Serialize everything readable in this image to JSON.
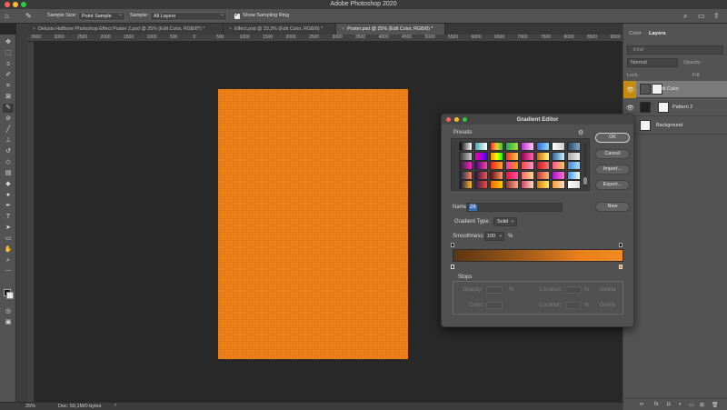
{
  "app": {
    "title": "Adobe Photoshop 2020"
  },
  "options_bar": {
    "sample_size_label": "Sample Size:",
    "sample_size_value": "Point Sample",
    "sample_label": "Sample:",
    "sample_value": "All Layers",
    "sampling_ring_label": "Show Sampling Ring",
    "sampling_ring_checked": true
  },
  "tabs": [
    {
      "label": "Delusio Halftone Photoshop Effect Poster 2.psd @ 25% (Edit Color, RGB/8*) *",
      "active": false
    },
    {
      "label": "Effect.psd @ 33,3% (Edit Color, RGB/8) *",
      "active": false
    },
    {
      "label": "Poster.psd @ 25% (Edit Color, RGB/8) *",
      "active": true
    }
  ],
  "ruler_ticks": [
    "3500",
    "3000",
    "2500",
    "2000",
    "1500",
    "1000",
    "500",
    "0",
    "500",
    "1000",
    "1500",
    "2000",
    "2500",
    "3000",
    "3500",
    "4000",
    "4500",
    "5000",
    "5500",
    "6000",
    "6500",
    "7000",
    "7500",
    "8000",
    "8500",
    "9000",
    "9500"
  ],
  "status_bar": {
    "zoom": "25%",
    "doc": "Doc: 50,1M/0 bytes"
  },
  "panels": {
    "tabs": [
      "Color",
      "Layers"
    ],
    "search_placeholder": "Kind",
    "blend_mode": "Normal",
    "opacity_label": "Opacity:",
    "lock_label": "Lock:",
    "fill_label": "Fill:",
    "layers": [
      {
        "name": "Edit Color",
        "selected": true
      },
      {
        "name": "Pattern 2",
        "selected": false
      },
      {
        "name": "Background",
        "selected": false
      }
    ]
  },
  "gradient_editor": {
    "title": "Gradient Editor",
    "presets_label": "Presets",
    "buttons": {
      "ok": "OK",
      "cancel": "Cancel",
      "import": "Import...",
      "export": "Export...",
      "new": "New"
    },
    "name_label": "Name:",
    "name_value": "26",
    "gradient_type_label": "Gradient Type:",
    "gradient_type_value": "Solid",
    "smoothness_label": "Smoothness:",
    "smoothness_value": "100",
    "percent": "%",
    "stops_label": "Stops",
    "opacity_label": "Opacity:",
    "location_label": "Location:",
    "color_label": "Color:",
    "delete_label": "Delete",
    "colors": {
      "gradient_start": "#5a3512",
      "gradient_end": "#f28a21"
    }
  },
  "colors": {
    "poster": "#ef8319",
    "canvas_bg": "#282828",
    "layer_selected": "#c48b12"
  }
}
